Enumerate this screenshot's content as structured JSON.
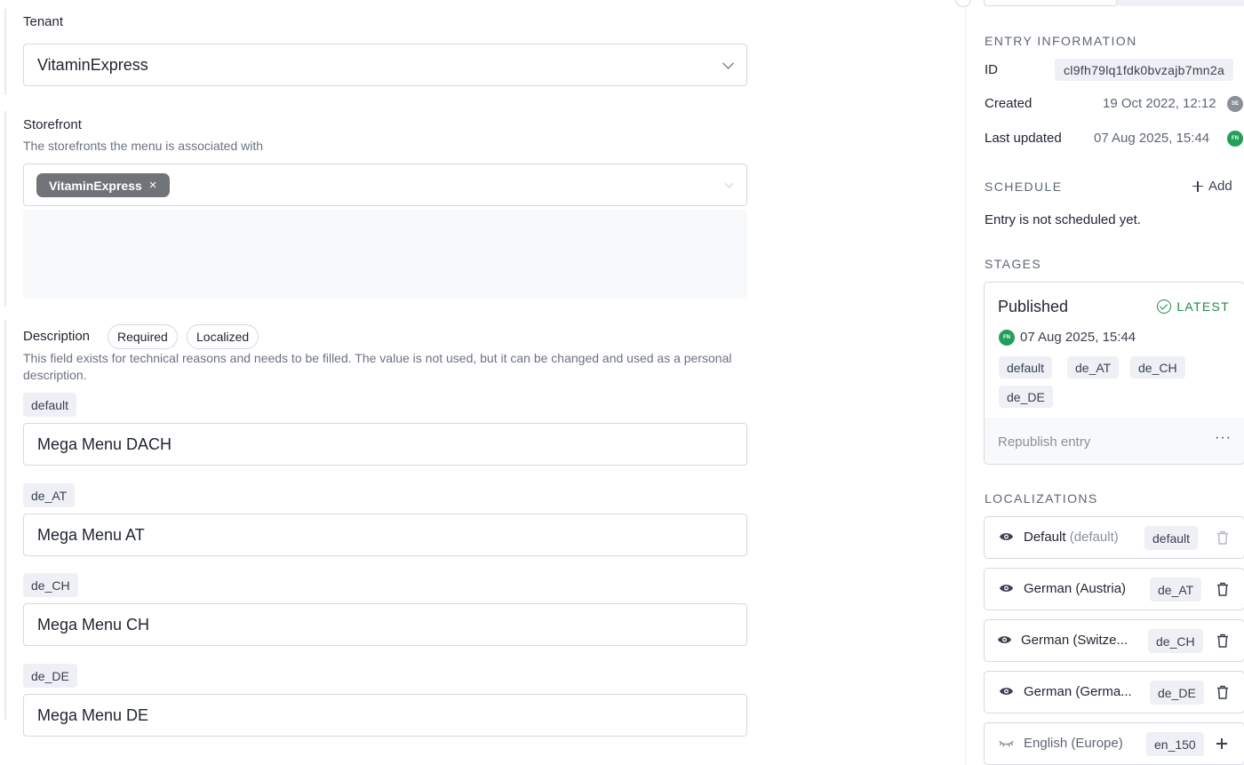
{
  "form": {
    "tenant": {
      "label": "Tenant",
      "value": "VitaminExpress"
    },
    "storefront": {
      "label": "Storefront",
      "help": "The storefronts the menu is associated with",
      "chip": "VitaminExpress",
      "chip_remove": "×"
    },
    "description": {
      "label": "Description",
      "badge_required": "Required",
      "badge_localized": "Localized",
      "help": "This field exists for technical reasons and needs to be filled. The value is not used, but it can be changed and used as a personal description.",
      "locales": [
        {
          "tag": "default",
          "value": "Mega Menu DACH"
        },
        {
          "tag": "de_AT",
          "value": "Mega Menu AT"
        },
        {
          "tag": "de_CH",
          "value": "Mega Menu CH"
        },
        {
          "tag": "de_DE",
          "value": "Mega Menu DE"
        }
      ]
    }
  },
  "sidebar": {
    "entry_info": {
      "heading": "ENTRY INFORMATION",
      "id_label": "ID",
      "id_value": "cl9fh79lq1fdk0bvzajb7mn2a",
      "created_label": "Created",
      "created_value": "19 Oct 2022, 12:12",
      "created_avatar": "SE",
      "updated_label": "Last updated",
      "updated_value": "07 Aug 2025, 15:44",
      "updated_avatar": "FN"
    },
    "schedule": {
      "heading": "SCHEDULE",
      "add_label": "Add",
      "empty_text": "Entry is not scheduled yet."
    },
    "stages": {
      "heading": "STAGES",
      "title": "Published",
      "latest_label": "LATEST",
      "avatar": "FN",
      "date": "07 Aug 2025, 15:44",
      "tags": [
        "default",
        "de_AT",
        "de_CH",
        "de_DE"
      ],
      "republish_label": "Republish entry",
      "more_label": "···"
    },
    "localizations": {
      "heading": "LOCALIZATIONS",
      "items": [
        {
          "name": "Default",
          "suffix": "(default)",
          "code": "default"
        },
        {
          "name": "German (Austria)",
          "suffix": "",
          "code": "de_AT"
        },
        {
          "name": "German (Switze...",
          "suffix": "",
          "code": "de_CH"
        },
        {
          "name": "German (Germa...",
          "suffix": "",
          "code": "de_DE"
        },
        {
          "name": "English (Europe)",
          "suffix": "",
          "code": "en_150"
        }
      ]
    }
  },
  "colors": {
    "accent_green": "#1f8a4c",
    "avatar_green": "#22a05a",
    "chip_gray": "#707378",
    "tag_bg": "#eef0f5",
    "border": "#d6d9e0"
  },
  "icons": {
    "chevron": "chevron-down-icon",
    "eye": "eye-icon",
    "eye_hidden": "eye-off-icon",
    "trash": "trash-icon",
    "plus": "plus-icon",
    "check": "check-circle-icon",
    "more": "more-horizontal-icon"
  }
}
